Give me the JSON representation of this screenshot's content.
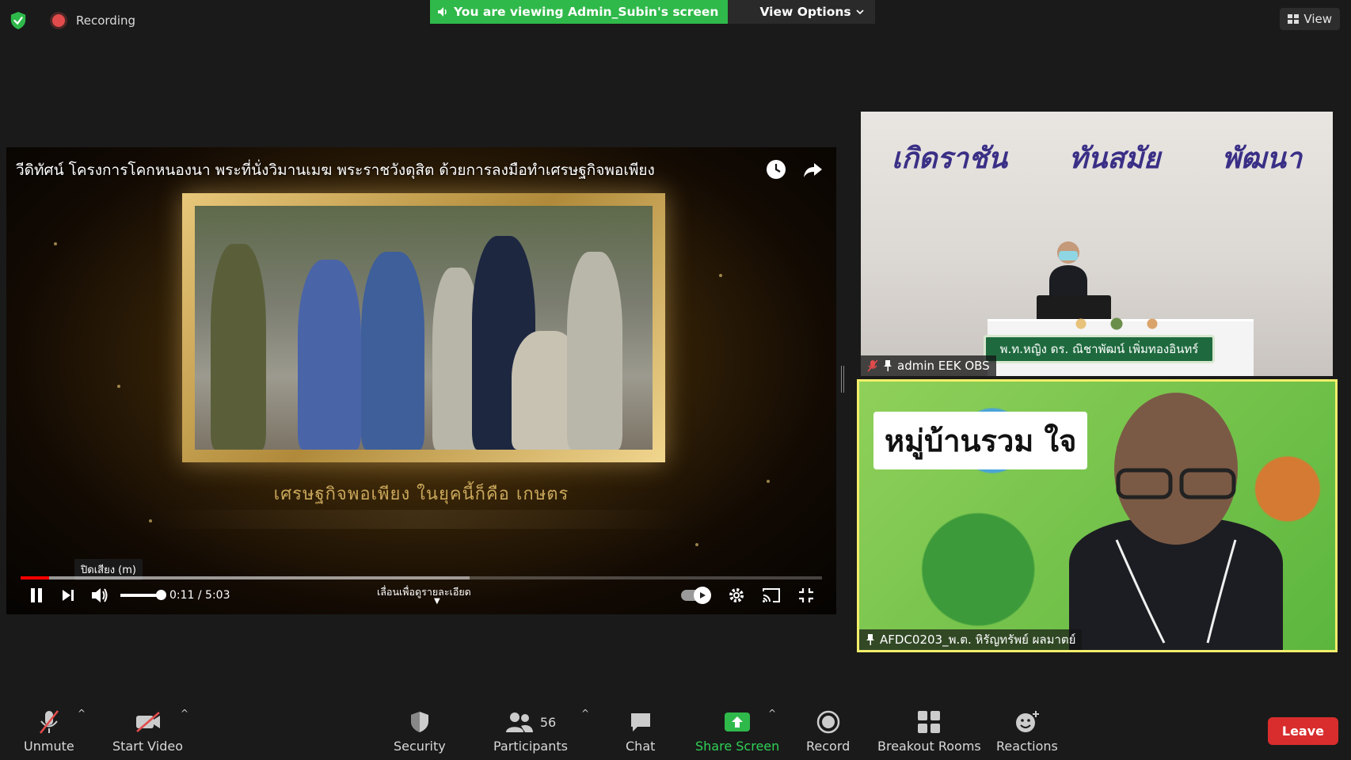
{
  "top": {
    "recording_label": "Recording",
    "viewing_text": "You are viewing Admin_Subin's screen",
    "view_options_label": "View Options",
    "view_label": "View"
  },
  "video": {
    "title": "วีดิทัศน์ โครงการโคกหนองนา พระที่นั่งวิมานเมฆ พระราชวังดุสิต ด้วยการลงมือทำเศรษฐกิจพอเพียง",
    "subtitle": "เศรษฐกิจพอเพียง ในยุคนี้ก็คือ เกษตร",
    "tooltip": "ปิดเสียง (m)",
    "time": "0:11 / 5:03",
    "chapter_label": "เลื่อนเพื่อดูรายละเอียด",
    "progress_fraction": 0.036,
    "buffer_fraction": 0.56
  },
  "tiles": [
    {
      "slogan": [
        "เกิดราชัน",
        "ทันสมัย",
        "พัฒนา"
      ],
      "namecard": "พ.ท.หญิง ดร. ณิชาพัฒน์ เพิ่มทองอินทร์",
      "name": "admin EEK OBS"
    },
    {
      "map_title": "หมู่บ้านรวม ใจ",
      "name": "AFDC0203_พ.ต. หิรัญทรัพย์ ผลมาตย์"
    }
  ],
  "toolbar": {
    "unmute": "Unmute",
    "start_video": "Start Video",
    "security": "Security",
    "participants": "Participants",
    "participants_count": "56",
    "chat": "Chat",
    "share_screen": "Share Screen",
    "record": "Record",
    "breakout_rooms": "Breakout Rooms",
    "reactions": "Reactions",
    "leave": "Leave"
  },
  "colors": {
    "zoom_green": "#2fb94a",
    "leave_red": "#d92d2d",
    "active_speaker": "#f3ee6b",
    "yt_red": "#ff0000"
  }
}
